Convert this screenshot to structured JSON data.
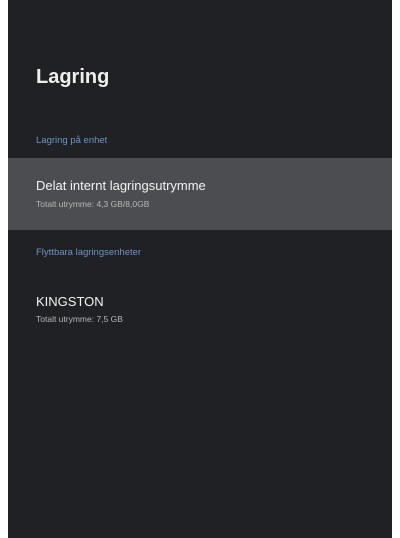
{
  "header": {
    "title": "Lagring"
  },
  "sections": [
    {
      "label": "Lagring på enhet",
      "items": [
        {
          "title": "Delat internt lagringsutrymme",
          "subtitle": "Totalt utrymme: 4,3 GB/8,0GB"
        }
      ]
    },
    {
      "label": "Flyttbara lagringsenheter",
      "items": [
        {
          "title": "KINGSTON",
          "subtitle": "Totalt utrymme: 7,5 GB"
        }
      ]
    }
  ]
}
